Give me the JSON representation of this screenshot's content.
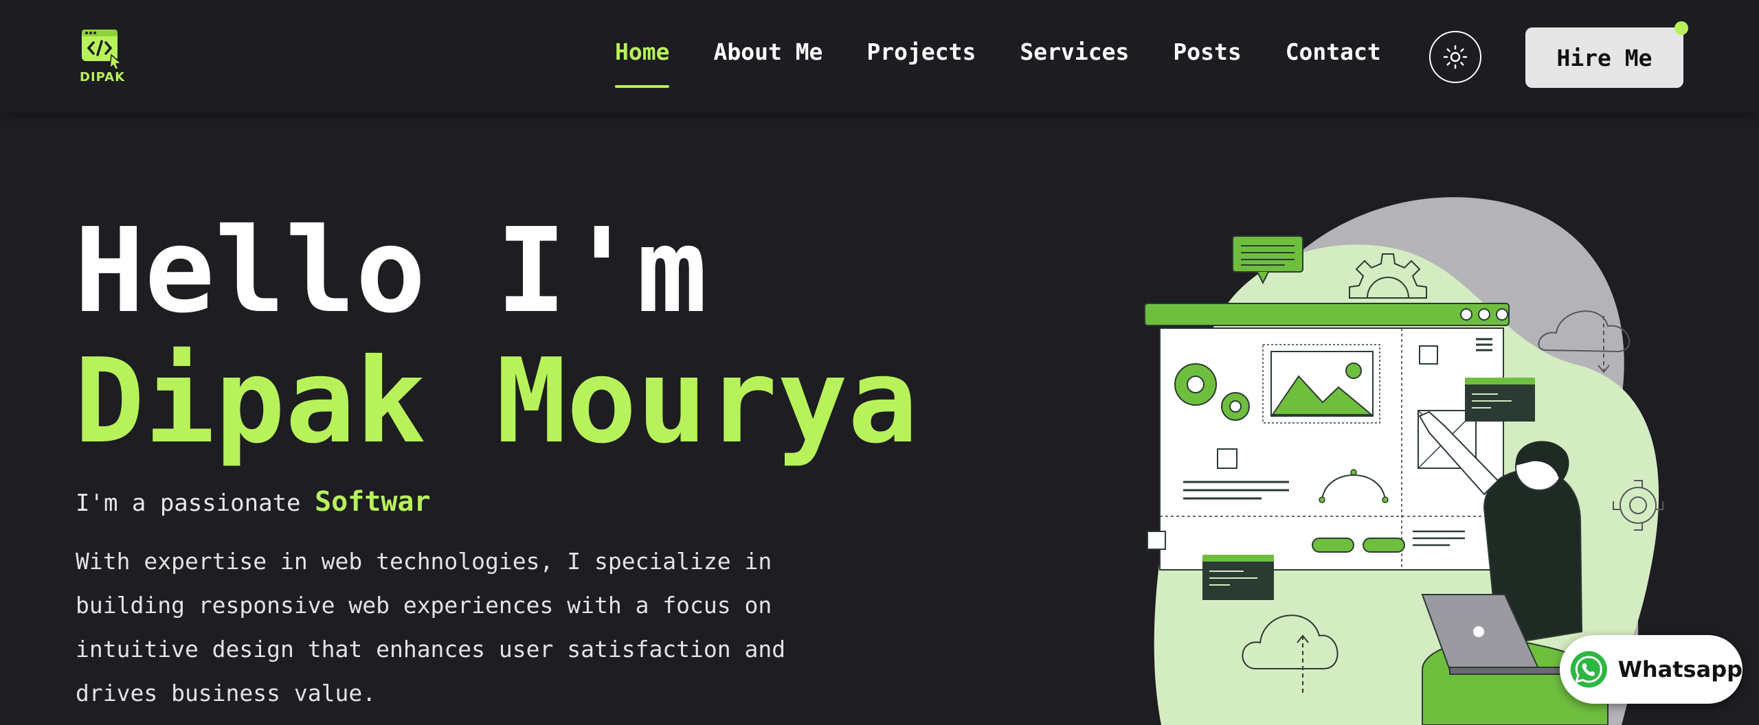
{
  "brand": {
    "logo_text": "DIPAK"
  },
  "nav": {
    "items": [
      {
        "label": "Home",
        "active": true
      },
      {
        "label": "About Me"
      },
      {
        "label": "Projects"
      },
      {
        "label": "Services"
      },
      {
        "label": "Posts"
      },
      {
        "label": "Contact"
      }
    ]
  },
  "header": {
    "theme_toggle_icon": "sun-icon",
    "hire_label": "Hire Me"
  },
  "hero": {
    "greeting": "Hello I'm",
    "name": "Dipak Mourya",
    "tagline_prefix": "I'm a passionate",
    "tagline_role": "Softwar",
    "description": "With expertise in web technologies, I specialize in building responsive web experiences with a focus on intuitive design that enhances user satisfaction and drives business value."
  },
  "whatsapp": {
    "label": "Whatsapp",
    "icon": "whatsapp-icon"
  },
  "colors": {
    "accent": "#b7f25a",
    "background": "#1d1d22",
    "illustration_green": "#6fbf3f",
    "illustration_light": "#d4ecc1"
  }
}
